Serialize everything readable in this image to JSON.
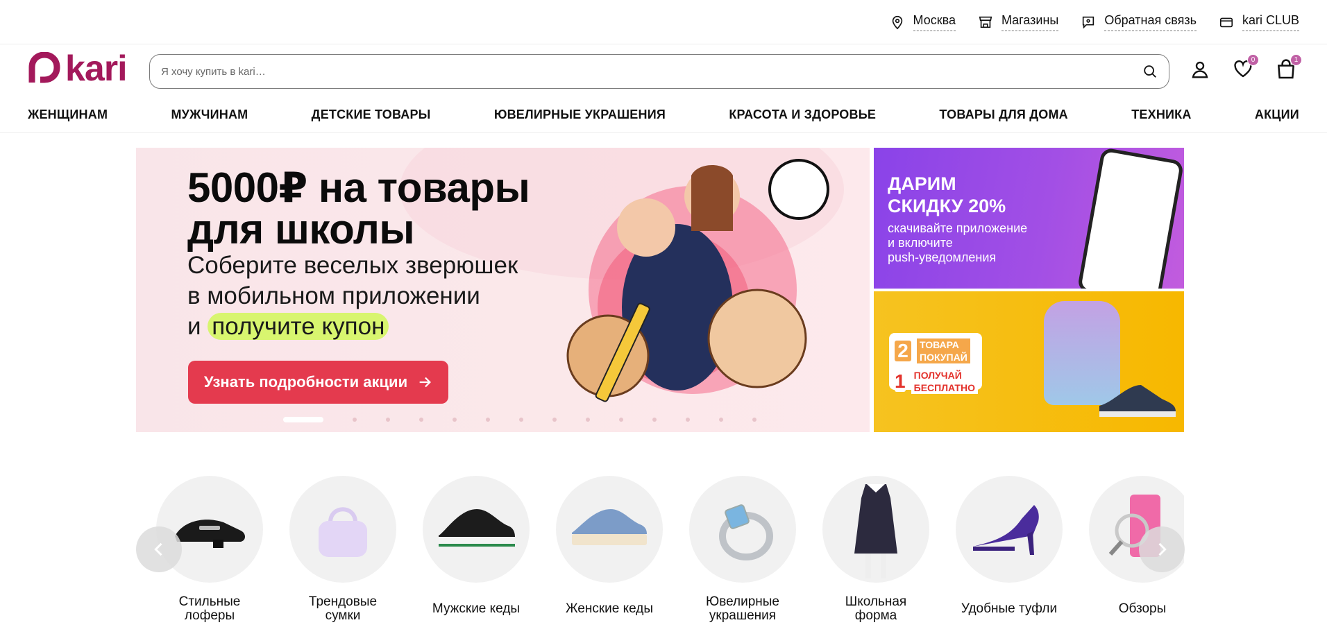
{
  "topbar": {
    "city": "Москва",
    "stores": "Магазины",
    "feedback": "Обратная связь",
    "club": "kari CLUB"
  },
  "header": {
    "logo_text": "kari",
    "search_placeholder": "Я хочу купить в kari…",
    "favorites_count": "0",
    "cart_count": "1"
  },
  "nav": {
    "items": [
      "ЖЕНЩИНАМ",
      "МУЖЧИНАМ",
      "ДЕТСКИЕ ТОВАРЫ",
      "ЮВЕЛИРНЫЕ УКРАШЕНИЯ",
      "КРАСОТА И ЗДОРОВЬЕ",
      "ТОВАРЫ ДЛЯ ДОМА",
      "ТЕХНИКА",
      "АКЦИИ"
    ]
  },
  "banner": {
    "headline_1": "5000₽ на товары",
    "headline_2": "для школы",
    "sub_1": "Соберите веселых зверюшек",
    "sub_2": "в мобильном приложении",
    "sub_3_prefix": "и",
    "sub_3_highlight": "получите купон",
    "button": "Узнать подробности акции",
    "slides_total": 14,
    "active_slide": 1
  },
  "side_banner_1": {
    "title_1": "ДАРИМ",
    "title_2": "СКИДКУ 20%",
    "text_1": "скачивайте приложение",
    "text_2": "и включите",
    "text_3": "push-уведомления"
  },
  "side_banner_2": {
    "n1": "2",
    "t1a": "ТОВАРА",
    "t1b": "ПОКУПАЙ",
    "n2": "1",
    "t2a": "ПОЛУЧАЙ",
    "t2b": "БЕСПЛАТНО"
  },
  "categories": [
    {
      "label": "Стильные\nлоферы",
      "icon": "loafer-icon"
    },
    {
      "label": "Трендовые\nсумки",
      "icon": "handbag-icon"
    },
    {
      "label": "Мужские кеды",
      "icon": "sneaker-icon"
    },
    {
      "label": "Женские кеды",
      "icon": "canvas-shoe-icon"
    },
    {
      "label": "Ювелирные\nукрашения",
      "icon": "ring-icon"
    },
    {
      "label": "Школьная\nформа",
      "icon": "dress-icon"
    },
    {
      "label": "Удобные туфли",
      "icon": "heel-icon"
    },
    {
      "label": "Обзоры",
      "icon": "reviews-icon"
    }
  ],
  "colors": {
    "brand": "#a3195b",
    "promo_button": "#e43a4e",
    "badge": "#c060a5",
    "highlight": "#d8f56f"
  }
}
